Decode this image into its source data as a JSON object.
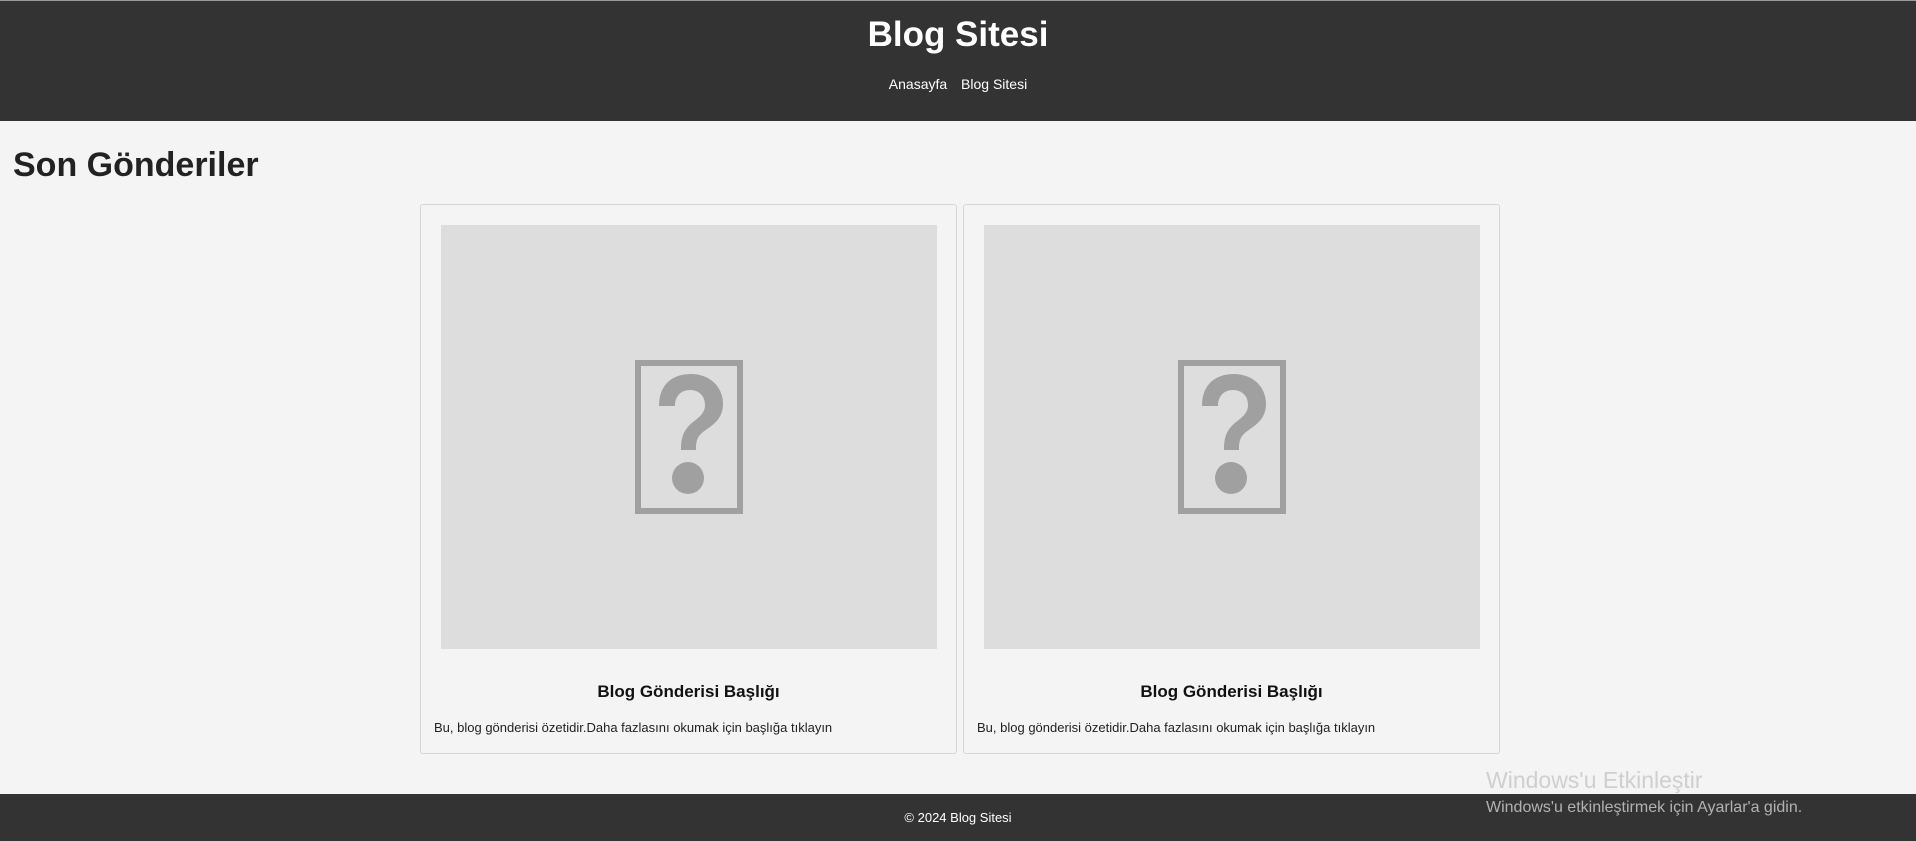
{
  "header": {
    "site_title": "Blog Sitesi",
    "nav": [
      {
        "label": "Anasayfa"
      },
      {
        "label": "Blog Sitesi"
      }
    ]
  },
  "main": {
    "heading": "Son Gönderiler",
    "posts": [
      {
        "title": "Blog Gönderisi Başlığı",
        "excerpt": "Bu, blog gönderisi özetidir.Daha fazlasını okumak için başlığa tıklayın",
        "image_icon": "broken-image-icon"
      },
      {
        "title": "Blog Gönderisi Başlığı",
        "excerpt": "Bu, blog gönderisi özetidir.Daha fazlasını okumak için başlığa tıklayın",
        "image_icon": "broken-image-icon"
      }
    ]
  },
  "footer": {
    "text": "© 2024 Blog Sitesi"
  },
  "watermark": {
    "title": "Windows'u Etkinleştir",
    "subtitle": "Windows'u etkinleştirmek için Ayarlar'a gidin."
  },
  "colors": {
    "header_bg": "#333333",
    "page_bg": "#f4f4f4",
    "image_placeholder_bg": "#dddddd",
    "icon_gray": "#a0a0a0"
  }
}
